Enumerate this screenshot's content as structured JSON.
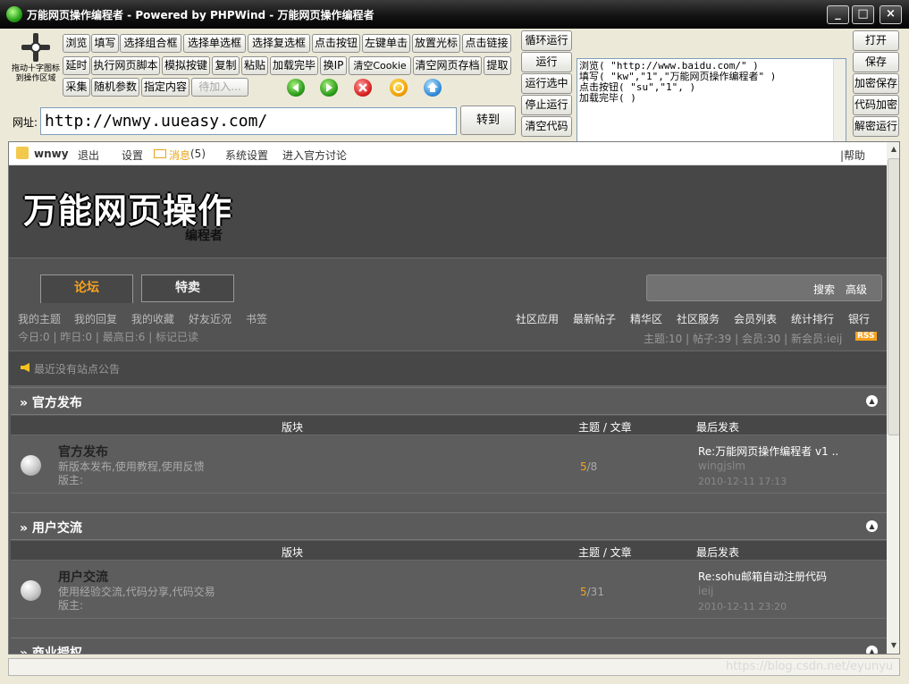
{
  "window": {
    "title": "万能网页操作编程者 - Powered by PHPWind - 万能网页操作编程者",
    "controls": [
      "_",
      "□",
      "×"
    ]
  },
  "move_widget": {
    "label": "拖动十字图标到操作区域"
  },
  "toolbar": {
    "row1": [
      "浏览",
      "填写",
      "选择组合框",
      "选择单选框",
      "选择复选框",
      "点击按钮",
      "左键单击",
      "放置光标",
      "点击链接"
    ],
    "row2": [
      "延时",
      "执行网页脚本",
      "模拟按键",
      "复制",
      "粘贴",
      "加载完毕",
      "换IP",
      "清空Cookie",
      "清空网页存档",
      "提取"
    ],
    "row3": [
      "采集",
      "随机参数",
      "指定内容"
    ],
    "disabled": "待加入...",
    "nav_icons": [
      "back-icon",
      "forward-icon",
      "stop-icon",
      "refresh-icon",
      "home-icon"
    ],
    "run_buttons": [
      "循环运行",
      "运行",
      "运行选中",
      "停止运行",
      "清空代码"
    ],
    "file_buttons": [
      "打开",
      "保存",
      "加密保存",
      "代码加密",
      "解密运行"
    ]
  },
  "address": {
    "label": "网址:",
    "value": "http://wnwy.uueasy.com/",
    "go": "转到"
  },
  "script": "浏览( \"http://www.baidu.com/\" )\n填写( \"kw\",\"1\",\"万能网页操作编程者\" )\n点击按钮( \"su\",\"1\", )\n加载完毕( )",
  "site": {
    "userbar": {
      "username": "wnwy",
      "logout": "退出",
      "settings": "设置",
      "messages": "消息",
      "msg_count": "(5)",
      "system": "系统设置",
      "official": "进入官方讨论",
      "help": "|帮助"
    },
    "logo": {
      "main": "万能网页操作",
      "sub": "编程者"
    },
    "tabs": [
      "论坛",
      "特卖"
    ],
    "search": {
      "label": "搜索",
      "advanced": "高级"
    },
    "left_links": [
      "我的主题",
      "我的回复",
      "我的收藏",
      "好友近况",
      "书签"
    ],
    "right_links": [
      "社区应用",
      "最新帖子",
      "精华区",
      "社区服务",
      "会员列表",
      "统计排行",
      "银行"
    ],
    "stats_left": "今日:0 | 昨日:0 | 最高日:6 | 标记已读",
    "stats_right": "主题:10 | 帖子:39 | 会员:30 | 新会员:ieij",
    "rss": "RSS",
    "notice": "最近没有站点公告",
    "columns": {
      "board": "版块",
      "topics": "主题 / 文章",
      "last": "最后发表"
    },
    "sections": [
      {
        "title": "» 官方发布",
        "forum": "官方发布",
        "desc": "新版本发布,使用教程,使用反馈",
        "mod": "版主:",
        "topics": "5",
        "posts": "/8",
        "last_title": "Re:万能网页操作编程者 v1 ..",
        "last_user": "wingjslm",
        "last_date": "2010-12-11 17:13"
      },
      {
        "title": "» 用户交流",
        "forum": "用户交流",
        "desc": "使用经验交流,代码分享,代码交易",
        "mod": "版主:",
        "topics": "5",
        "posts": "/31",
        "last_title": "Re:sohu邮箱自动注册代码",
        "last_user": "ieij",
        "last_date": "2010-12-11 23:20"
      },
      {
        "title": "» 商业授权"
      }
    ]
  },
  "watermark": "https://blog.csdn.net/eyunyu"
}
